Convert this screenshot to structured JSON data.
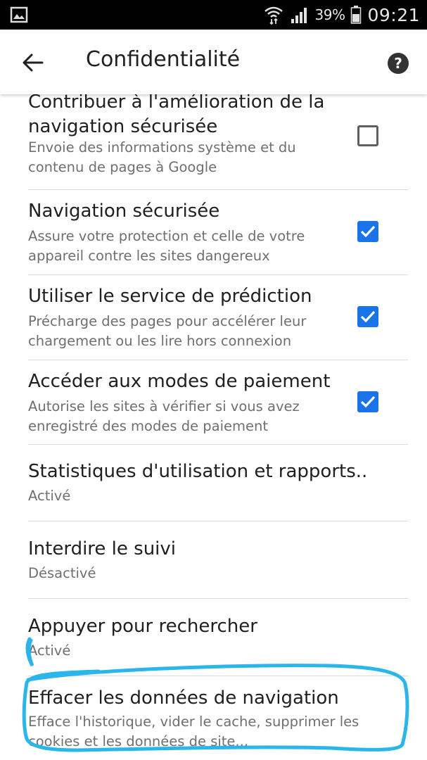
{
  "status_bar": {
    "battery_percent": "39%",
    "time": "09:21",
    "icons": [
      "image-icon",
      "wifi-icon",
      "signal-icon",
      "battery-icon"
    ]
  },
  "app_bar": {
    "title": "Confidentialité",
    "back_icon": "arrow-back-icon",
    "help_icon": "help-icon"
  },
  "settings": [
    {
      "title_line1": "Contribuer à l'amélioration de la",
      "title_line2": "navigation sécurisée",
      "summary_line1": "Envoie des informations système et du",
      "summary_line2": "contenu de pages à Google",
      "checked": false
    },
    {
      "title": "Navigation sécurisée",
      "summary_line1": "Assure votre protection et celle de votre",
      "summary_line2": "appareil contre les sites dangereux",
      "checked": true
    },
    {
      "title": "Utiliser le service de prédiction",
      "summary_line1": "Précharge des pages pour accélérer leur",
      "summary_line2": "chargement ou les lire hors connexion",
      "checked": true
    },
    {
      "title": "Accéder aux modes de paiement",
      "summary_line1": "Autorise les sites à vérifier si vous avez",
      "summary_line2": "enregistré des modes de paiement",
      "checked": true
    },
    {
      "title": "Statistiques d'utilisation et rapports..",
      "summary": "Activé"
    },
    {
      "title": "Interdire le suivi",
      "summary": "Désactivé"
    },
    {
      "title": "Appuyer pour rechercher",
      "summary": "Activé"
    },
    {
      "title": "Effacer les données de navigation",
      "summary_line1": "Efface l'historique, vider le cache, supprimer les",
      "summary_line2": "cookies et les données de site..."
    }
  ],
  "colors": {
    "checkbox_checked": "#1a73e8",
    "checkbox_unchecked_border": "#5f5f5f",
    "annotation_stroke": "#2ab6ea"
  }
}
